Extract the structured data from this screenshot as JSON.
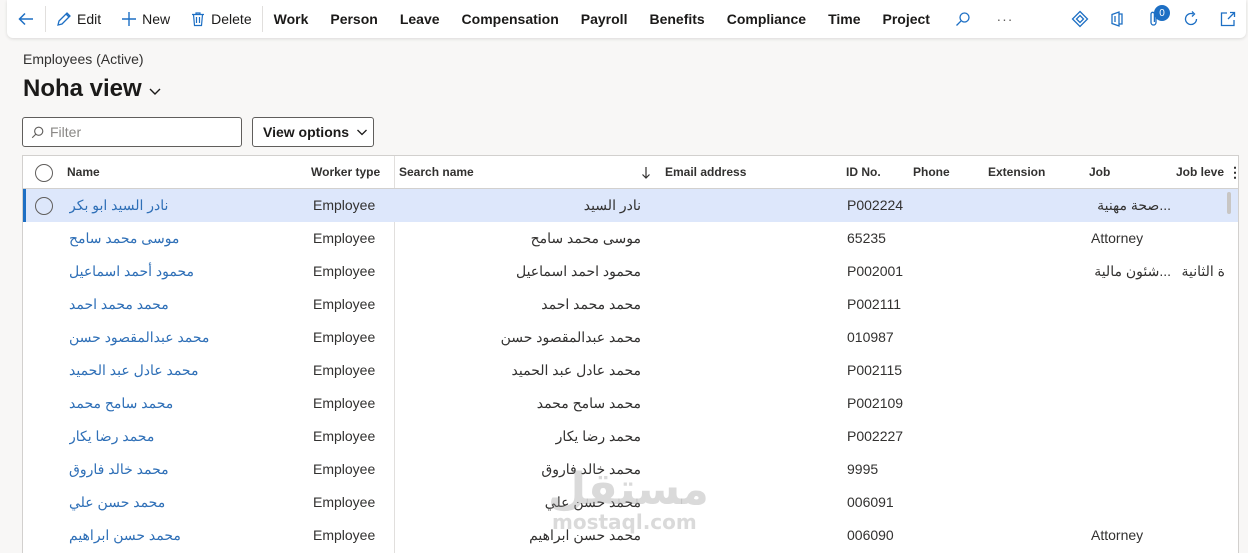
{
  "toolbar": {
    "edit": "Edit",
    "new": "New",
    "delete": "Delete",
    "menus": [
      "Work",
      "Person",
      "Leave",
      "Compensation",
      "Payroll",
      "Benefits",
      "Compliance",
      "Time",
      "Project"
    ],
    "more": "···",
    "notification_count": "0"
  },
  "header": {
    "breadcrumb": "Employees (Active)",
    "title": "Noha view"
  },
  "filter": {
    "placeholder": "Filter"
  },
  "view_options": "View options",
  "grid": {
    "columns": {
      "name": "Name",
      "worker_type": "Worker type",
      "search_name": "Search name",
      "email": "Email address",
      "id": "ID No.",
      "phone": "Phone",
      "extension": "Extension",
      "job": "Job",
      "job_level": "Job leve"
    },
    "rows": [
      {
        "name": "نادر السيد ابو بكر",
        "worker_type": "Employee",
        "search_name": "نادر السيد",
        "id": "P002224",
        "job": "...صحة مهنية",
        "job_level": ""
      },
      {
        "name": "موسى محمد سامح",
        "worker_type": "Employee",
        "search_name": "موسى محمد سامح",
        "id": "65235",
        "job": "Attorney",
        "job_level": ""
      },
      {
        "name": "محمود أحمد اسماعيل",
        "worker_type": "Employee",
        "search_name": "محمود احمد اسماعيل",
        "id": "P002001",
        "job": "...شئون مالية",
        "job_level": "ة الثانية"
      },
      {
        "name": "محمد محمد احمد",
        "worker_type": "Employee",
        "search_name": "محمد محمد احمد",
        "id": "P002111",
        "job": "",
        "job_level": ""
      },
      {
        "name": "محمد عبدالمقصود حسن",
        "worker_type": "Employee",
        "search_name": "محمد عبدالمقصود حسن",
        "id": "010987",
        "job": "",
        "job_level": ""
      },
      {
        "name": "محمد عادل عبد الحميد",
        "worker_type": "Employee",
        "search_name": "محمد عادل عبد الحميد",
        "id": "P002115",
        "job": "",
        "job_level": ""
      },
      {
        "name": "محمد سامح محمد",
        "worker_type": "Employee",
        "search_name": "محمد سامح محمد",
        "id": "P002109",
        "job": "",
        "job_level": ""
      },
      {
        "name": "محمد رضا يكار",
        "worker_type": "Employee",
        "search_name": "محمد رضا يكار",
        "id": "P002227",
        "job": "",
        "job_level": ""
      },
      {
        "name": "محمد خالد فاروق",
        "worker_type": "Employee",
        "search_name": "محمد خالد فاروق",
        "id": "9995",
        "job": "",
        "job_level": ""
      },
      {
        "name": "محمد حسن علي",
        "worker_type": "Employee",
        "search_name": "محمد حسن علي",
        "id": "006091",
        "job": "",
        "job_level": ""
      },
      {
        "name": "محمد حسن ابراهيم",
        "worker_type": "Employee",
        "search_name": "محمد حسن ابراهيم",
        "id": "006090",
        "job": "Attorney",
        "job_level": ""
      }
    ]
  },
  "watermark": {
    "arabic": "مستقل",
    "latin": "mostaql.com"
  }
}
